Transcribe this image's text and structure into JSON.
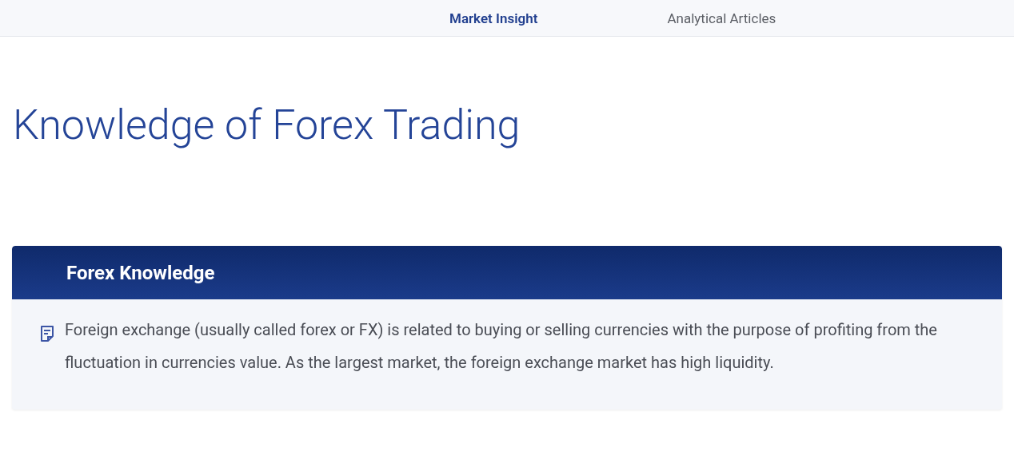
{
  "tabs": [
    {
      "label": "Market Insight",
      "selected": true
    },
    {
      "label": "Analytical Articles",
      "selected": false
    }
  ],
  "page_title": "Knowledge of Forex Trading",
  "section": {
    "title": "Forex Knowledge",
    "text": "Foreign exchange (usually called forex or FX) is related to buying or selling currencies with the purpose of profiting from the fluctuation in currencies value. As the largest market, the foreign exchange market has high liquidity."
  }
}
